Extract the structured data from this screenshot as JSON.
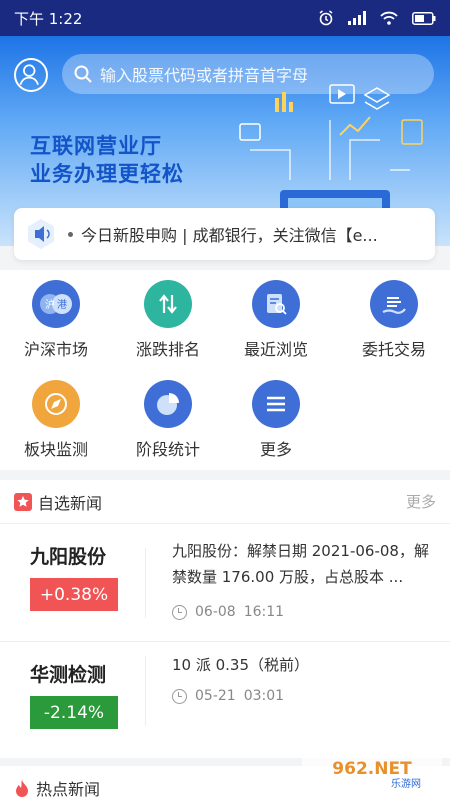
{
  "status_bar": {
    "time": "下午 1:22"
  },
  "search": {
    "placeholder": "输入股票代码或者拼音首字母"
  },
  "banner": {
    "line1": "互联网营业厅",
    "line2": "业务办理更轻松"
  },
  "ticker": {
    "text": "今日新股申购 | 成都银行，关注微信【e..."
  },
  "grid": {
    "items": [
      {
        "label": "沪深市场",
        "icon": "hushen-market-icon",
        "color": "#3f6fd6"
      },
      {
        "label": "涨跌排名",
        "icon": "updown-ranking-icon",
        "color": "#2eb5a0"
      },
      {
        "label": "最近浏览",
        "icon": "recent-browse-icon",
        "color": "#3f6fd6"
      },
      {
        "label": "委托交易",
        "icon": "entrust-trade-icon",
        "color": "#3f6fd6"
      },
      {
        "label": "板块监测",
        "icon": "sector-monitor-icon",
        "color": "#f0a63c"
      },
      {
        "label": "阶段统计",
        "icon": "stage-stats-icon",
        "color": "#3f6fd6"
      },
      {
        "label": "更多",
        "icon": "more-menu-icon",
        "color": "#3f6fd6"
      }
    ],
    "badge_left": "沪",
    "badge_right": "港"
  },
  "watch_news": {
    "title": "自选新闻",
    "more": "更多",
    "items": [
      {
        "stock": "九阳股份",
        "change": "+0.38%",
        "change_color": "#f05454",
        "headline": "九阳股份：解禁日期 2021-06-08，解禁数量 176.00 万股，占总股本 ...",
        "date": "06-08",
        "time": "16:11"
      },
      {
        "stock": "华测检测",
        "change": "-2.14%",
        "change_color": "#2a9a3a",
        "headline": "10 派 0.35（税前）",
        "date": "05-21",
        "time": "03:01"
      }
    ]
  },
  "hot_news": {
    "title": "热点新闻"
  },
  "watermark": {
    "text": "962.NET",
    "subtext": "乐游网"
  }
}
